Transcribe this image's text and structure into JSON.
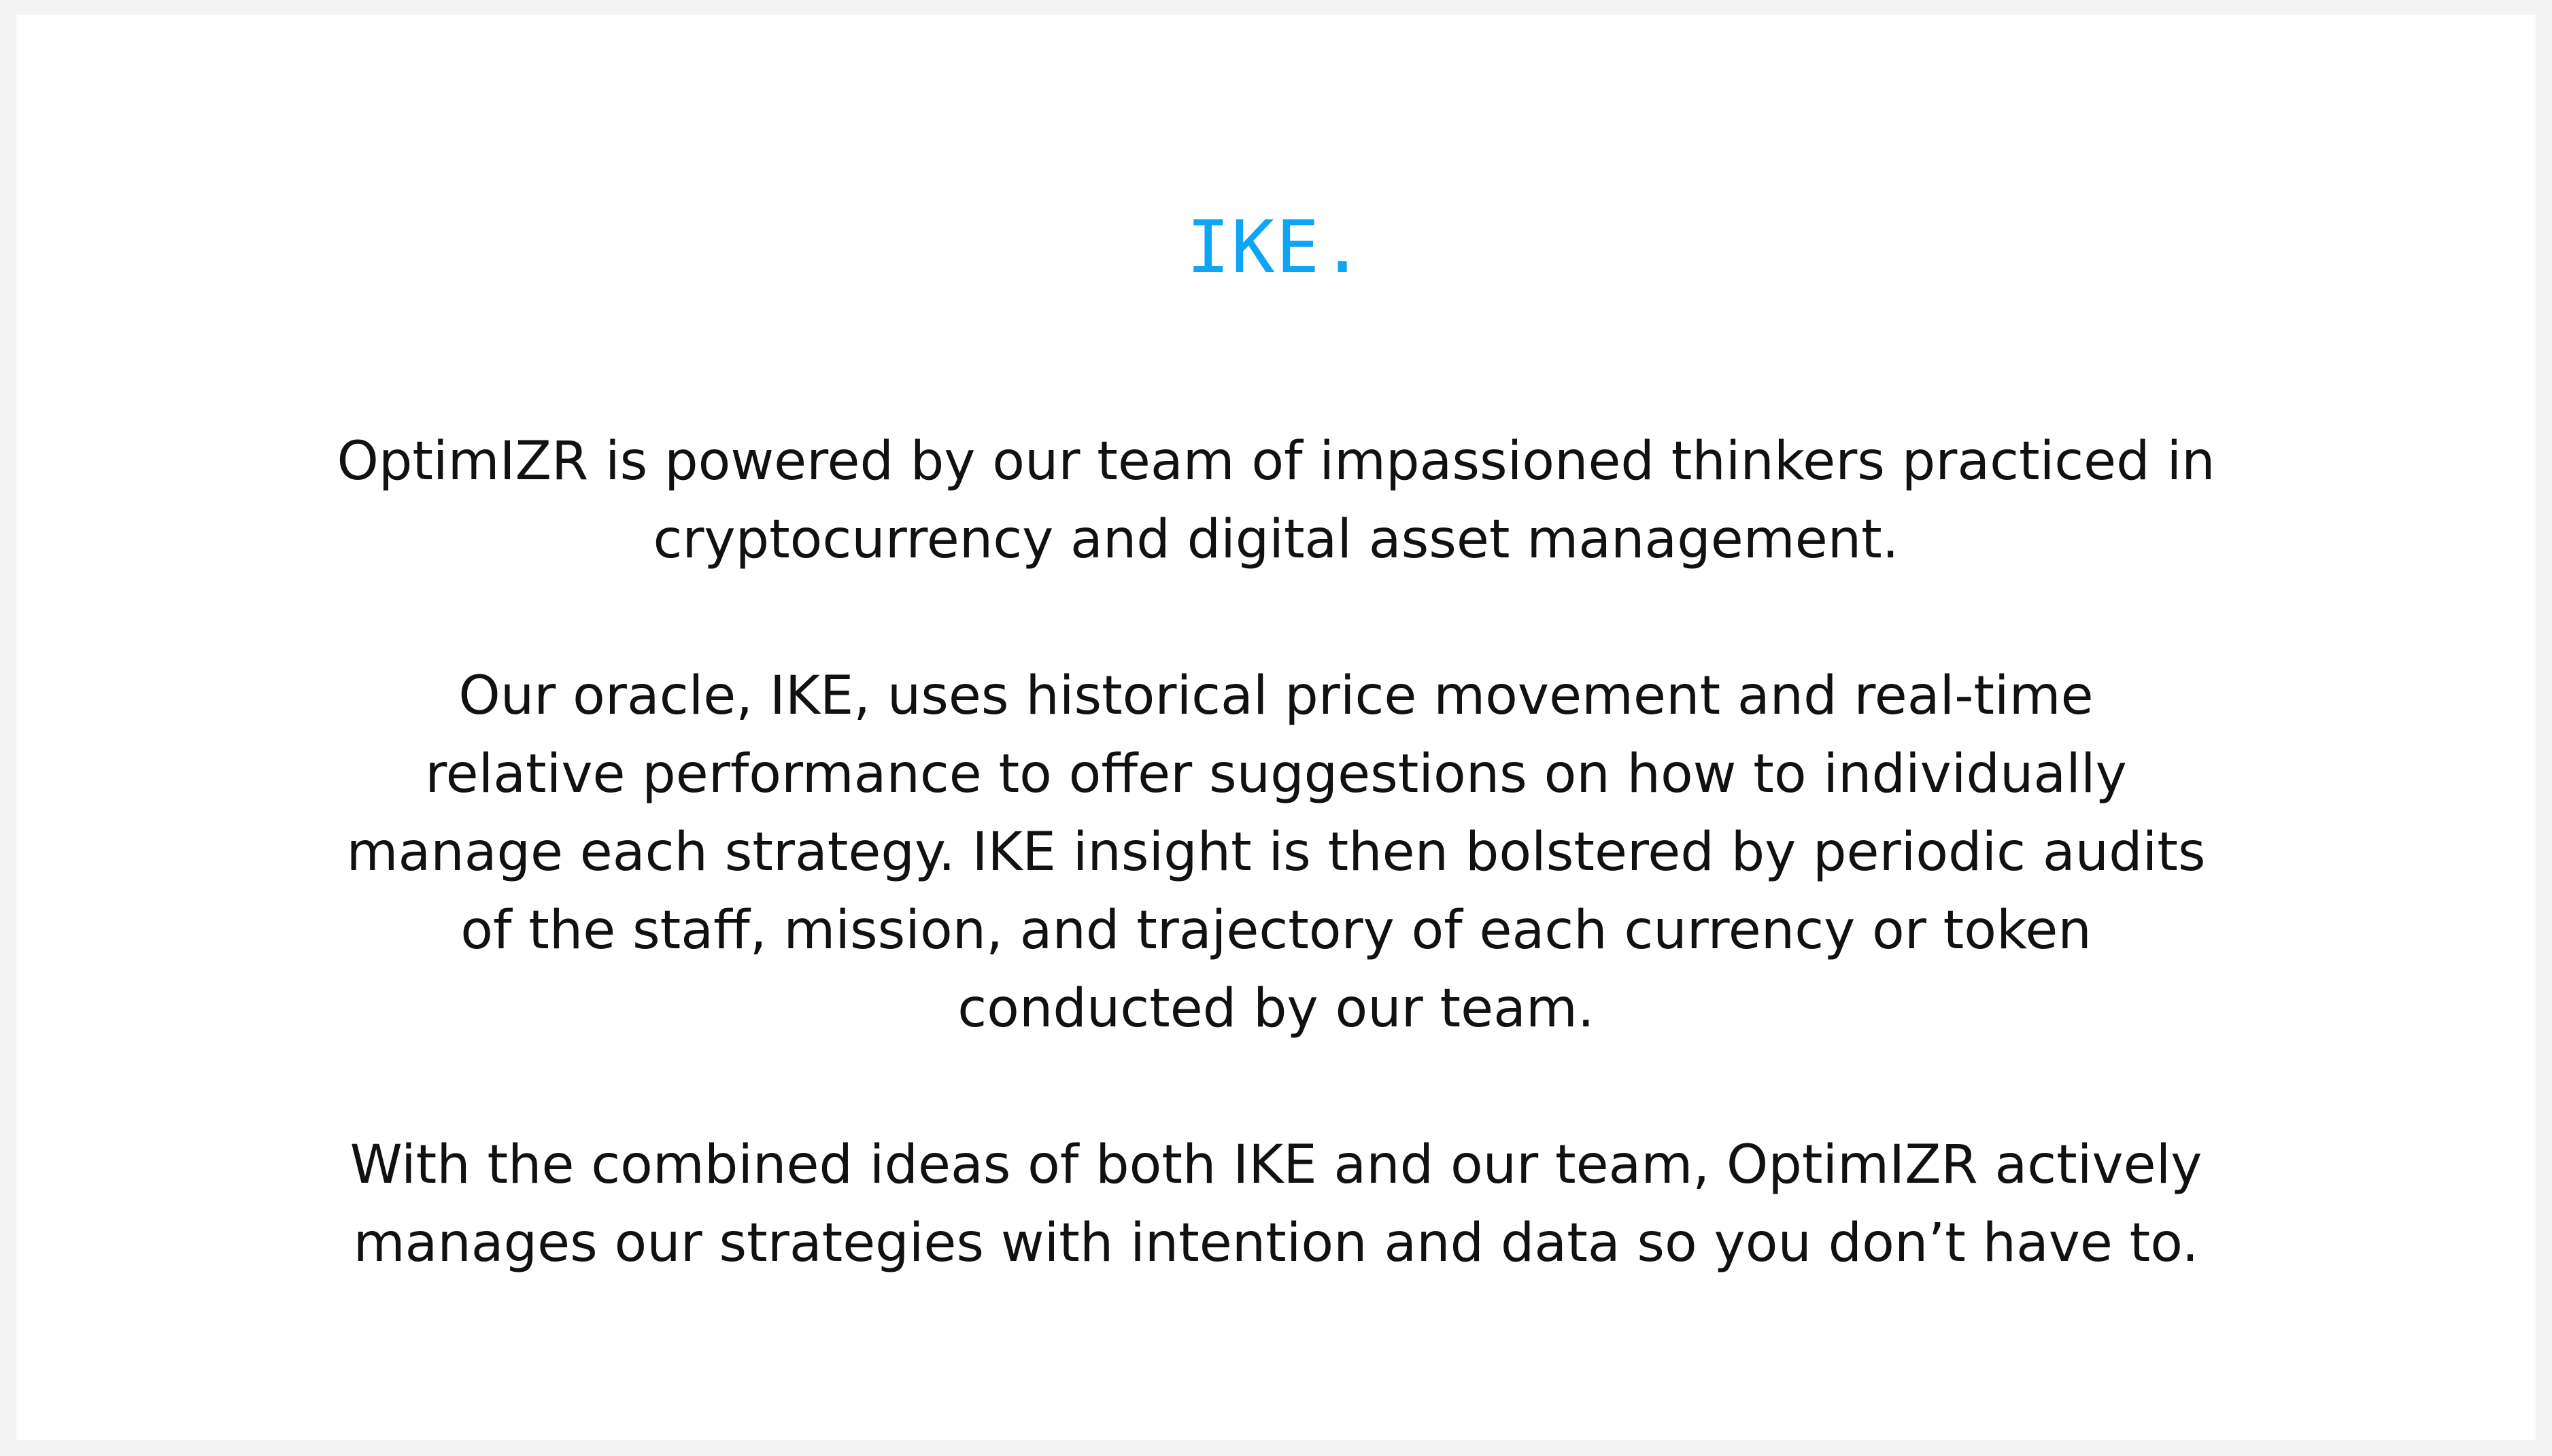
{
  "brand": {
    "name": "IKE."
  },
  "about": {
    "paragraphs": [
      {
        "lines": [
          "OptimIZR is powered by our team of impassioned thinkers practiced in",
          "cryptocurrency and digital asset management."
        ]
      },
      {
        "lines": [
          "Our oracle, IKE, uses historical price movement and real-time",
          "relative performance to offer suggestions on how to individually",
          "manage each strategy. IKE insight is then bolstered by periodic audits",
          "of the staff, mission, and trajectory of each currency or token",
          "conducted by our team."
        ]
      },
      {
        "lines": [
          "With the combined ideas of both IKE and our team, OptimIZR actively",
          "manages our strategies with intention and data so you don’t have to."
        ]
      }
    ]
  },
  "colors": {
    "accent": "#0ea5f4",
    "text": "#111111",
    "background": "#ffffff",
    "outer_background": "#f4f4f4"
  }
}
